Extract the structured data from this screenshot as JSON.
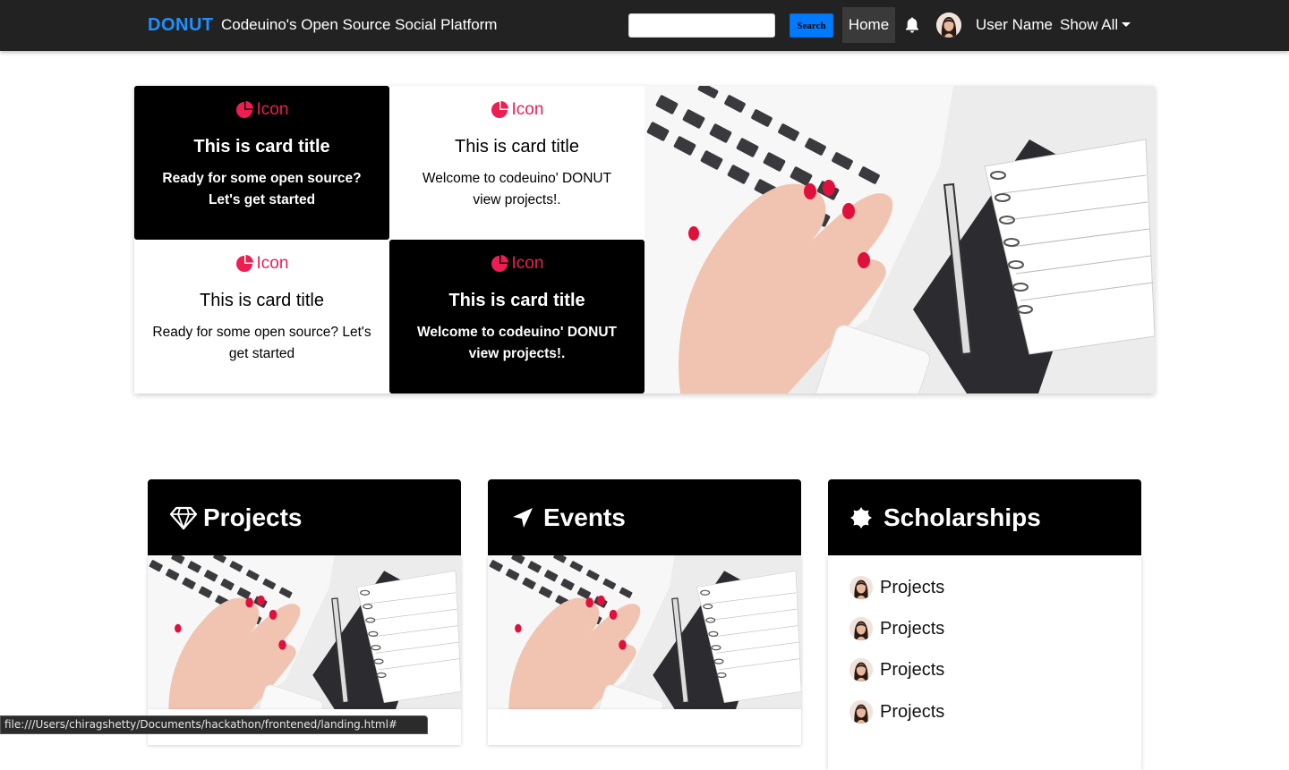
{
  "navbar": {
    "brand": "DONUT",
    "tagline": "Codeuino's Open Source Social Platform",
    "search_placeholder": "",
    "search_button": "Search",
    "home_link": "Home",
    "user_name": "User Name",
    "show_all": "Show All"
  },
  "cards": [
    {
      "icon_label": "Icon",
      "title": "This is card title",
      "text": "Ready for some open source? Let's get started"
    },
    {
      "icon_label": "Icon",
      "title": "This is card title",
      "text": "Welcome to codeuino' DONUT view projects!."
    },
    {
      "icon_label": "Icon",
      "title": "This is card title",
      "text": "Ready for some open source? Let's get started"
    },
    {
      "icon_label": "Icon",
      "title": "This is card title",
      "text": "Welcome to codeuino' DONUT view projects!."
    }
  ],
  "sections": {
    "projects": {
      "title": "Projects"
    },
    "events": {
      "title": "Events"
    },
    "scholarships": {
      "title": "Scholarships",
      "items": [
        "Projects",
        "Projects",
        "Projects",
        "Projects"
      ]
    }
  },
  "status_bar": {
    "url": "file:///Users/chiragshetty/Documents/hackathon/frontened/landing.html#"
  },
  "colors": {
    "brand": "#1e90ff",
    "accent_icon": "#ee1d52",
    "navbar_bg": "#222222",
    "search_button_bg": "#007bff"
  },
  "icons": {
    "card_icon": "pie-chart-icon",
    "projects": "diamond-icon",
    "events": "location-arrow-icon",
    "scholarships": "certificate-icon",
    "notifications": "bell-icon"
  }
}
